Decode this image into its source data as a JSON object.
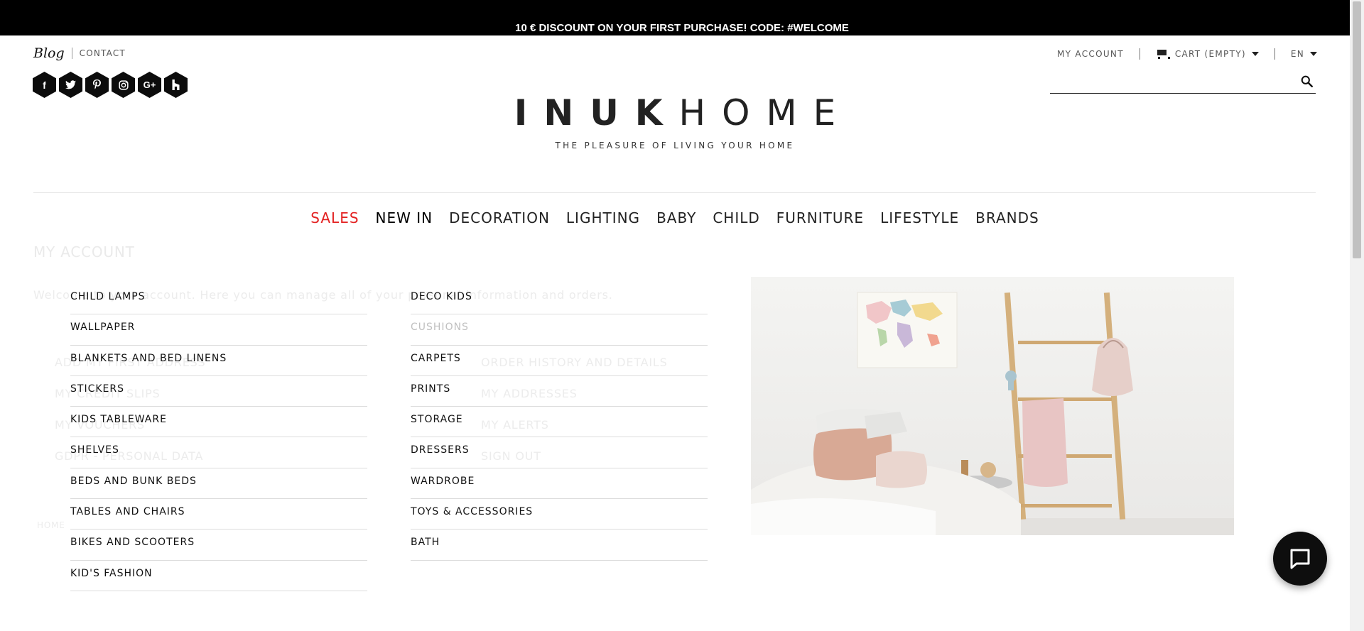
{
  "promo": {
    "text": "10 € DISCOUNT ON YOUR FIRST PURCHASE! CODE: #WELCOME"
  },
  "header": {
    "blog": "Blog",
    "contact": "CONTACT",
    "my_account": "MY ACCOUNT",
    "cart": "CART (EMPTY)",
    "language": "EN",
    "search_placeholder": "",
    "social_icons": [
      "facebook-icon",
      "twitter-icon",
      "pinterest-icon",
      "instagram-icon",
      "google-plus-icon",
      "houzz-icon"
    ]
  },
  "logo": {
    "bold": "INUK",
    "light": "HOME",
    "tagline": "THE PLEASURE OF LIVING YOUR HOME"
  },
  "nav": {
    "items": [
      "SALES",
      "NEW IN",
      "DECORATION",
      "LIGHTING",
      "BABY",
      "CHILD",
      "FURNITURE",
      "LIFESTYLE",
      "BRANDS"
    ],
    "sales_color": "#e32222"
  },
  "background_page": {
    "title": "MY ACCOUNT",
    "welcome": "Welcome to your account. Here you can manage all of your personal information and orders.",
    "left_links": [
      "ADD MY FIRST ADDRESS",
      "MY CREDIT SLIPS",
      "MY VOUCHERS",
      "GDPR - PERSONAL DATA"
    ],
    "right_links": [
      "ORDER HISTORY AND DETAILS",
      "MY ADDRESSES",
      "MY ALERTS",
      "SIGN OUT"
    ],
    "home": "HOME"
  },
  "menu": {
    "col1": [
      "CHILD LAMPS",
      "WALLPAPER",
      "BLANKETS AND BED LINENS",
      "STICKERS",
      "KIDS TABLEWARE",
      "SHELVES",
      "BEDS AND BUNK BEDS",
      "TABLES AND CHAIRS",
      "BIKES AND SCOOTERS",
      "KID'S FASHION"
    ],
    "col2": [
      "DECO KIDS",
      "CUSHIONS",
      "CARPETS",
      "PRINTS",
      "STORAGE",
      "DRESSERS",
      "WARDROBE",
      "TOYS & ACCESSORIES",
      "BATH"
    ]
  }
}
